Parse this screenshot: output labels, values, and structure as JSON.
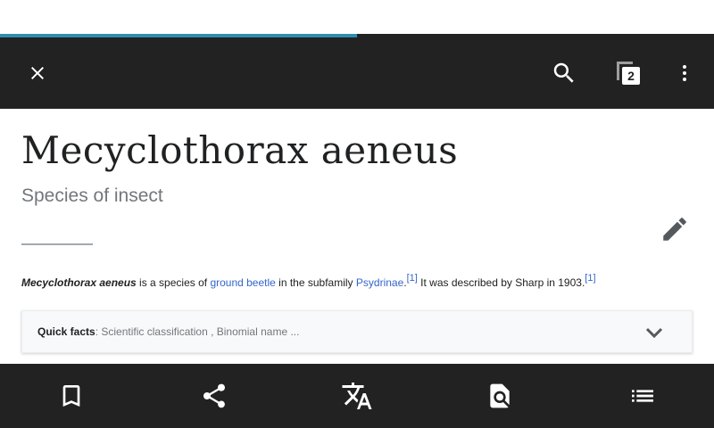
{
  "page_load_progress": 0.5,
  "toolbar": {
    "close_icon": "close-icon",
    "search_icon": "search-icon",
    "tabs_icon": "tabs-icon",
    "tabs_count": "2",
    "overflow_icon": "overflow-menu-icon"
  },
  "article": {
    "title": "Mecyclothorax aeneus",
    "description": "Species of insect",
    "intro": {
      "subject": "Mecyclothorax aeneus",
      "text1": " is a species of ",
      "link1": "ground beetle",
      "text2": " in the subfamily ",
      "link2": "Psydrinae",
      "text3": ".",
      "ref1": "[1]",
      "text4": " It was described by Sharp in 1903.",
      "ref2": "[1]"
    },
    "quick_facts": {
      "label": "Quick facts",
      "separator": ": ",
      "summary": "Scientific classification , Binomial name ..."
    }
  },
  "bottom_bar": {
    "items": [
      "bookmark-icon",
      "share-icon",
      "translate-icon",
      "find-in-page-icon",
      "table-of-contents-icon"
    ]
  },
  "colors": {
    "toolbar_bg": "#222222",
    "progress": "#2e8db0",
    "link": "#3366cc",
    "icon": "#ffffff"
  }
}
